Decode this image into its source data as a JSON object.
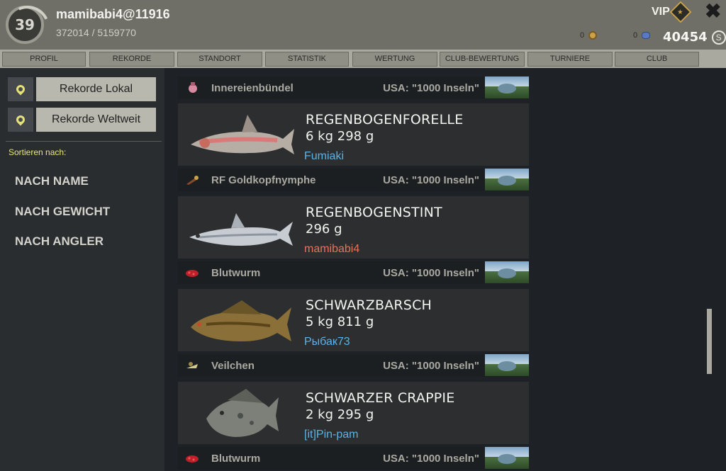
{
  "header": {
    "level": "39",
    "username": "mamibabi4@11916",
    "xp": "372014 / 5159770",
    "vip_label": "VIP",
    "bait_coins": "0",
    "gold": "0",
    "silver": "40454",
    "silver_symbol": "S"
  },
  "tabs": [
    "PROFIL",
    "REKORDE",
    "STANDORT",
    "STATISTIK",
    "WERTUNG",
    "CLUB-BEWERTUNG",
    "TURNIERE",
    "CLUB"
  ],
  "sidebar": {
    "local_button": "Rekorde Lokal",
    "world_button": "Rekorde Weltweit",
    "sort_label": "Sortieren nach:",
    "sort_options": [
      "NACH NAME",
      "NACH GEWICHT",
      "NACH ANGLER"
    ]
  },
  "records": {
    "top_bait": {
      "name": "Innereienbündel",
      "location": "USA: \"1000 Inseln\""
    },
    "items": [
      {
        "fish": "REGENBOGENFORELLE",
        "weight": "6 kg 298 g",
        "angler": "Fumiaki",
        "angler_color": "#5ab4e8",
        "bait": "RF Goldkopfnymphe",
        "location": "USA: \"1000 Inseln\""
      },
      {
        "fish": "REGENBOGENSTINT",
        "weight": "296 g",
        "angler": "mamibabi4",
        "angler_color": "#e8735a",
        "bait": "Blutwurm",
        "location": "USA: \"1000 Inseln\""
      },
      {
        "fish": "SCHWARZBARSCH",
        "weight": "5 kg 811 g",
        "angler": "Рыбак73",
        "angler_color": "#5ab4e8",
        "bait": "Veilchen",
        "location": "USA: \"1000 Inseln\""
      },
      {
        "fish": "SCHWARZER CRAPPIE",
        "weight": "2 kg 295 g",
        "angler": "[it]Pin-pam",
        "angler_color": "#5ab4e8",
        "bait": "Blutwurm",
        "location": "USA: \"1000 Inseln\""
      }
    ]
  },
  "icons": {
    "close": "close-icon",
    "pin": "location-pin-icon",
    "coin": "coin-icon",
    "gem": "gem-icon",
    "silver": "silver-coin-icon"
  }
}
